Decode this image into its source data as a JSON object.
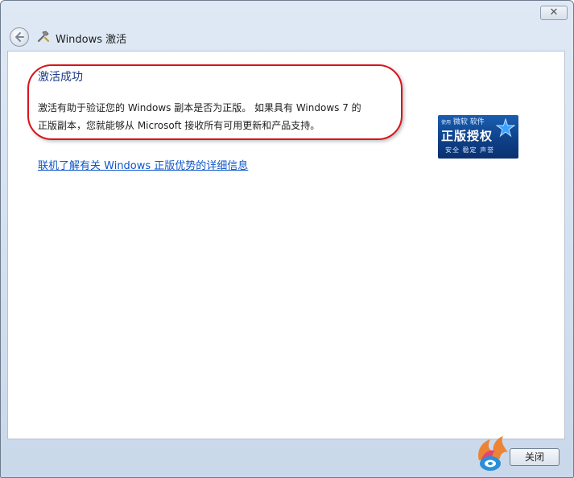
{
  "window": {
    "title": "Windows 激活",
    "close_glyph": "✕"
  },
  "content": {
    "heading": "激活成功",
    "description_line1": "激活有助于验证您的 Windows 副本是否为正版。 如果具有 Windows 7 的",
    "description_line2": "正版副本，您就能够从 Microsoft 接收所有可用更新和产品支持。",
    "link": "联机了解有关 Windows 正版优势的详细信息"
  },
  "badge": {
    "top_small": "使用",
    "top_text": "微软",
    "top_suffix": "软件",
    "main_text": "正版授权",
    "bottom_text": "安全 稳定 声誉"
  },
  "footer": {
    "close_button_label": "关闭"
  },
  "colors": {
    "heading": "#1d3a8a",
    "link": "#0e56c8",
    "highlight": "#d8141b",
    "badge_bg": "#0e3f86"
  },
  "icons": {
    "back": "back-arrow-icon",
    "app": "activation-key-icon",
    "badge_star": "star-icon",
    "brand": "brand-logo-icon"
  }
}
